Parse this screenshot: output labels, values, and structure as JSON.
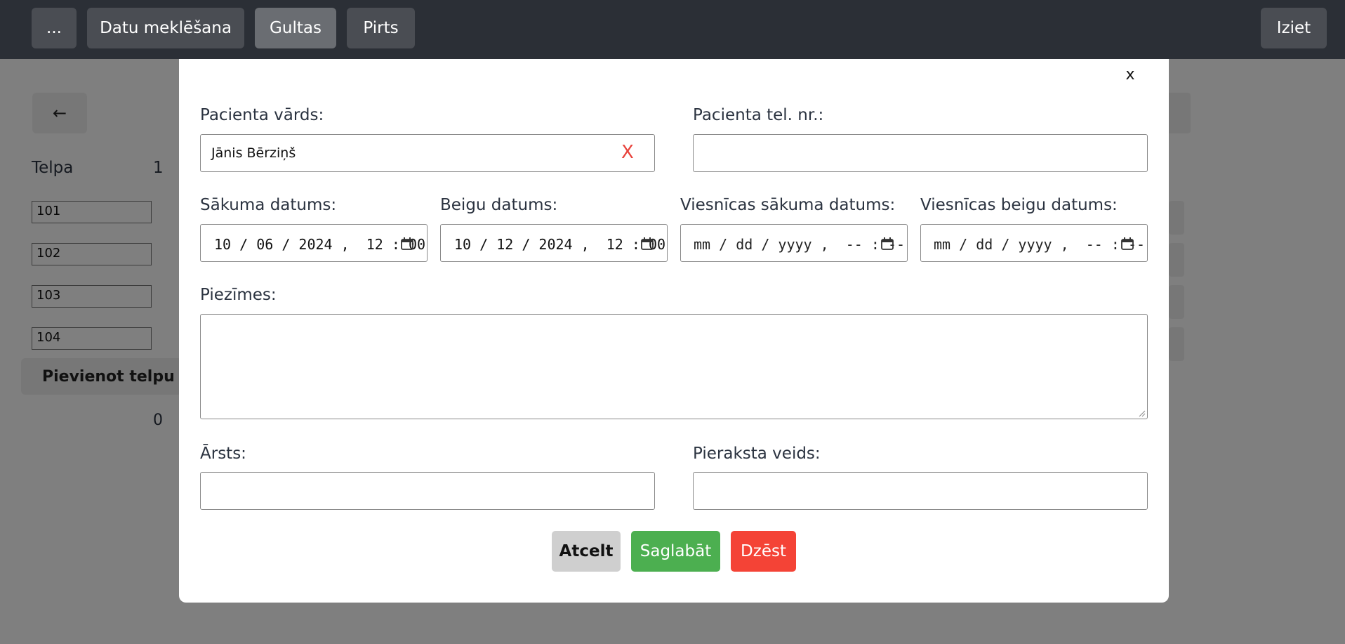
{
  "topnav": {
    "menu_label": "...",
    "search_label": "Datu meklēšana",
    "beds_label": "Gultas",
    "sauna_label": "Pirts",
    "logout_label": "Iziet"
  },
  "background": {
    "back_arrow": "←",
    "room_header": "Telpa",
    "room_header_count": "1",
    "rooms": [
      "101",
      "102",
      "103",
      "104"
    ],
    "add_room_label": "Pievienot telpu",
    "second_count": "0"
  },
  "modal": {
    "close_label": "x",
    "patient_name_label": "Pacienta vārds:",
    "patient_name_value": "Jānis Bērziņš",
    "clear_label": "X",
    "patient_phone_label": "Pacienta tel. nr.:",
    "patient_phone_value": "",
    "start_date_label": "Sākuma datums:",
    "start_date_value": "10 / 06 / 2024 ,  12 : 00",
    "end_date_label": "Beigu datums:",
    "end_date_value": "10 / 12 / 2024 ,  12 : 00",
    "hotel_start_label": "Viesnīcas sākuma datums:",
    "hotel_start_value": "mm / dd / yyyy ,  -- : --",
    "hotel_end_label": "Viesnīcas beigu datums:",
    "hotel_end_value": "mm / dd / yyyy ,  -- : --",
    "notes_label": "Piezīmes:",
    "notes_value": "",
    "doctor_label": "Ārsts:",
    "doctor_value": "",
    "appointment_type_label": "Pieraksta veids:",
    "appointment_type_value": "",
    "cancel_label": "Atcelt",
    "save_label": "Saglabāt",
    "delete_label": "Dzēst"
  },
  "colors": {
    "topbar": "#2b2f36",
    "save": "#4caf50",
    "delete": "#f44336",
    "cancel": "#cfcfcf",
    "clear_x": "#e8423b"
  },
  "icons": {
    "calendar": "calendar-icon"
  }
}
